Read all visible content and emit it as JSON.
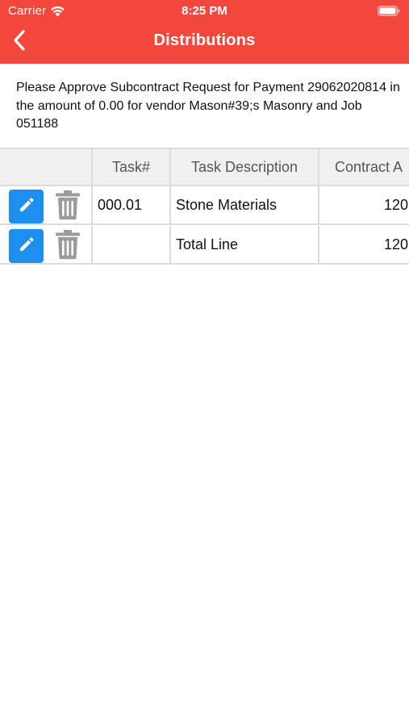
{
  "status_bar": {
    "carrier": "Carrier",
    "time": "8:25 PM"
  },
  "nav": {
    "title": "Distributions",
    "back_icon": "chevron-left-icon"
  },
  "message": "Please Approve Subcontract Request for Payment 29062020814 in the amount of 0.00 for vendor Mason#39;s Masonry and Job 051188",
  "table": {
    "columns": [
      "Task#",
      "Task Description",
      "Contract A"
    ],
    "rows": [
      {
        "task": "000.01",
        "description": "Stone Materials",
        "amount": "120"
      },
      {
        "task": "",
        "description": "Total Line",
        "amount": "120"
      }
    ]
  },
  "colors": {
    "header_bg": "#f4473c",
    "edit_button": "#1d8ff0",
    "delete_icon": "#9b9b9b",
    "grid_line": "#dcdcdc"
  }
}
